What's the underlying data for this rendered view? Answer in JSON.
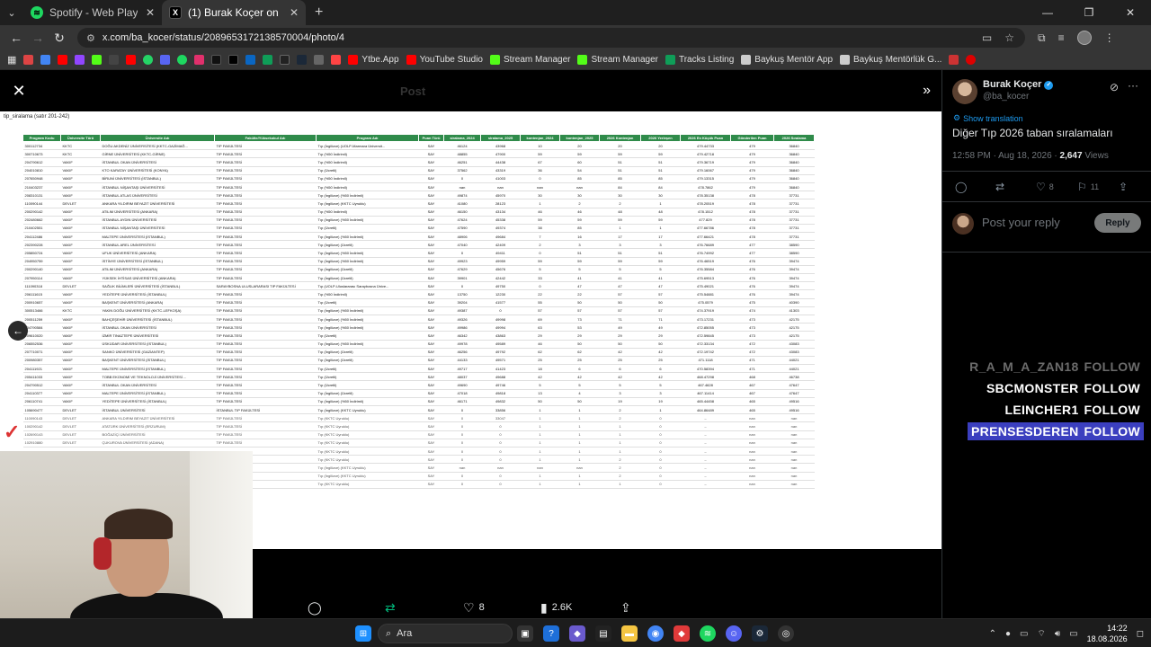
{
  "browser": {
    "tabs": [
      {
        "title": "Spotify - Web Player: Herkes için",
        "icon": "spotify-icon",
        "active": false
      },
      {
        "title": "(1) Burak Koçer on X: \"Geçen se",
        "icon": "x-logo-icon",
        "active": true
      }
    ],
    "url": "x.com/ba_kocer/status/2089653172138570004/photo/4",
    "bookmarks": [
      {
        "label": "Ytbe.App",
        "color": "#ff0000"
      },
      {
        "label": "YouTube Studio",
        "color": "#ff0000"
      },
      {
        "label": "Stream Manager",
        "color": "#53fc18"
      },
      {
        "label": "Stream Manager",
        "color": "#53fc18"
      },
      {
        "label": "Tracks Listing",
        "color": "#0f9d58"
      },
      {
        "label": "Baykuş Mentör App",
        "color": "#cccccc"
      },
      {
        "label": "Baykuş Mentörlük G...",
        "color": "#cccccc"
      }
    ]
  },
  "viewer": {
    "ghost_post_label": "Post",
    "sheet_label": "tip_siralama  (satır 201-242)",
    "table": {
      "headers": [
        "Program Kodu",
        "Üniversite Türü",
        "Üniversite Adı",
        "Fakülte/Yüksekokul Adı",
        "Program Adı",
        "Puan Türü",
        "siralama_2024",
        "siralama_2025",
        "kontenjan_2024",
        "kontenjan_2025",
        "2026 Kontenjan",
        "2026 Yerleşen",
        "2026 En Küçük Puan",
        "Gönderilen Puan",
        "2026 Sıralama"
      ],
      "rows": [
        [
          "300112734",
          "KKTC",
          "DOĞU AKDENİZ ÜNİVERSİTESİ (KKTC-GAZİMAĞ...",
          "TIP FAKÜLTESİ",
          "Tıp (İngilizce) (UOLP-Marmara Üniversit...",
          "SAY",
          "46124",
          "43968",
          "10",
          "20",
          "20",
          "20",
          "479.44733",
          "479",
          "36840"
        ],
        [
          "300710673",
          "KKTC",
          "GİRNE ÜNİVERSİTESİ (KKTC-GİRNE)",
          "TIP FAKÜLTESİ",
          "Tıp (%50 İndirimli)",
          "SAY",
          "48855",
          "47900",
          "59",
          "59",
          "59",
          "59",
          "479.42718",
          "479",
          "36840"
        ],
        [
          "204790612",
          "VAKIF",
          "İSTANBUL OKAN ÜNİVERSİTESİ",
          "TIP FAKÜLTESİ",
          "Tıp (%50 İndirimli)",
          "SAY",
          "46251",
          "44438",
          "67",
          "60",
          "51",
          "51",
          "479.36719",
          "479",
          "36840"
        ],
        [
          "204010810",
          "VAKIF",
          "KTO KARATAY ÜNİVERSİTESİ (KONYA)",
          "TIP FAKÜLTESİ",
          "Tıp (Ücretli)",
          "SAY",
          "37562",
          "43319",
          "36",
          "54",
          "51",
          "51",
          "479.16067",
          "479",
          "36840"
        ],
        [
          "207650948",
          "VAKIF",
          "BİRUNİ ÜNİVERSİTESİ (İSTANBUL)",
          "TIP FAKÜLTESİ",
          "Tıp (%50 İndirimli)",
          "SAY",
          "0",
          "41003",
          "0",
          "85",
          "85",
          "85",
          "479.13315",
          "479",
          "36840"
        ],
        [
          "210403237",
          "VAKIF",
          "İSTANBUL NİŞANTAŞI ÜNİVERSİTESİ",
          "TIP FAKÜLTESİ",
          "Tıp (%50 İndirimli)",
          "SAY",
          "nan",
          "nan",
          "nan",
          "nan",
          "84",
          "84",
          "478.7862",
          "479",
          "36840"
        ],
        [
          "208310131",
          "VAKIF",
          "İSTANBUL ATLAS ÜNİVERSİTESİ",
          "TIP FAKÜLTESİ",
          "Tıp (İngilizce) (%50 İndirimli)",
          "SAY",
          "49874",
          "45970",
          "30",
          "30",
          "30",
          "30",
          "478.35138",
          "478",
          "37731"
        ],
        [
          "110090144",
          "DEVLET",
          "ANKARA YILDIRIM BEYAZIT ÜNİVERSİTESİ",
          "TIP FAKÜLTESİ",
          "Tıp (İngilizce) (KKTC Uyruklu)",
          "SAY",
          "41080",
          "28123",
          "1",
          "2",
          "2",
          "1",
          "478.20519",
          "478",
          "37731"
        ],
        [
          "200290142",
          "VAKIF",
          "ATILIM ÜNİVERSİTESİ (ANKARA)",
          "TIP FAKÜLTESİ",
          "Tıp (%50 İndirimli)",
          "SAY",
          "46150",
          "43134",
          "46",
          "46",
          "48",
          "48",
          "478.1512",
          "478",
          "37731"
        ],
        [
          "202480662",
          "VAKIF",
          "İSTANBUL AYDIN ÜNİVERSİTESİ",
          "TIP FAKÜLTESİ",
          "Tıp (İngilizce) (%50 İndirimli)",
          "SAY",
          "47624",
          "45338",
          "59",
          "59",
          "59",
          "59",
          "477.829",
          "478",
          "37731"
        ],
        [
          "210402551",
          "VAKIF",
          "İSTANBUL NİŞANTAŞI ÜNİVERSİTESİ",
          "TIP FAKÜLTESİ",
          "Tıp (Ücretli)",
          "SAY",
          "47590",
          "49374",
          "38",
          "85",
          "1",
          "1",
          "477.66786",
          "478",
          "37731"
        ],
        [
          "204112486",
          "VAKIF",
          "MALTEPE ÜNİVERSİTESİ (İSTANBUL)",
          "TIP FAKÜLTESİ",
          "Tıp (İngilizce) (%50 İndirimli)",
          "SAY",
          "48906",
          "49684",
          "7",
          "16",
          "17",
          "17",
          "477.66421",
          "478",
          "37731"
        ],
        [
          "202390228",
          "VAKIF",
          "İSTANBUL AREL ÜNİVERSİTESİ",
          "TIP FAKÜLTESİ",
          "Tıp (İngilizce) (Ücretli)",
          "SAY",
          "47040",
          "42409",
          "2",
          "3",
          "3",
          "3",
          "476.76689",
          "477",
          "38590"
        ],
        [
          "205850724",
          "VAKIF",
          "UFUK ÜNİVERSİTESİ (ANKARA)",
          "TIP FAKÜLTESİ",
          "Tıp (İngilizce) (%50 İndirimli)",
          "SAY",
          "0",
          "49411",
          "0",
          "51",
          "51",
          "51",
          "476.74992",
          "477",
          "38590"
        ],
        [
          "204950759",
          "VAKIF",
          "İSTİNYE ÜNİVERSİTESİ (İSTANBUL)",
          "TIP FAKÜLTESİ",
          "Tıp (İngilizce) (%50 İndirimli)",
          "SAY",
          "49923",
          "49959",
          "59",
          "59",
          "59",
          "59",
          "476.46519",
          "476",
          "39474"
        ],
        [
          "200290140",
          "VAKIF",
          "ATILIM ÜNİVERSİTESİ (ANKARA)",
          "TIP FAKÜLTESİ",
          "Tıp (İngilizce) (Ücretli)",
          "SAY",
          "47629",
          "45676",
          "5",
          "5",
          "5",
          "5",
          "476.35584",
          "476",
          "39474"
        ],
        [
          "207950114",
          "VAKIF",
          "YÜKSEK İHTİSAS ÜNİVERSİTESİ (ANKARA)",
          "TIP FAKÜLTESİ",
          "Tıp (İngilizce) (Ücretli)",
          "SAY",
          "39901",
          "42442",
          "33",
          "41",
          "41",
          "41",
          "475.69513",
          "476",
          "39474"
        ],
        [
          "111090318",
          "DEVLET",
          "SAĞLIK BİLİMLERİ ÜNİVERSİTESİ (İSTANBUL)",
          "SARAYBOSNA ULUSLARARASI TIP FAKÜLTESİ",
          "Tıp (UOLP-Uluslararası Saraybosna Ünive...",
          "SAY",
          "0",
          "49750",
          "0",
          "47",
          "47",
          "47",
          "475.49021",
          "476",
          "39474"
        ],
        [
          "206111615",
          "VAKIF",
          "YEDİTEPE ÜNİVERSİTESİ (İSTANBUL)",
          "TIP FAKÜLTESİ",
          "Tıp (%50 İndirimli)",
          "SAY",
          "13750",
          "12230",
          "22",
          "22",
          "57",
          "57",
          "475.54881",
          "476",
          "39474"
        ],
        [
          "200910657",
          "VAKIF",
          "BAŞKENT ÜNİVERSİTESİ (ANKARA)",
          "TIP FAKÜLTESİ",
          "Tıp (Ücretli)",
          "SAY",
          "39204",
          "41577",
          "55",
          "50",
          "50",
          "50",
          "475.0579",
          "475",
          "40390"
        ],
        [
          "300513466",
          "KKTC",
          "YAKIN DOĞU ÜNİVERSİTESİ (KKTC-LEFKOŞA)",
          "TIP FAKÜLTESİ",
          "Tıp (İngilizce) (%50 İndirimli)",
          "SAY",
          "49387",
          "0",
          "57",
          "57",
          "57",
          "57",
          "474.37919",
          "474",
          "41303"
        ],
        [
          "200511259",
          "VAKIF",
          "BAHÇEŞEHİR ÜNİVERSİTESİ (İSTANBUL)",
          "TIP FAKÜLTESİ",
          "Tıp (İngilizce) (%50 İndirimli)",
          "SAY",
          "49326",
          "49998",
          "69",
          "73",
          "71",
          "71",
          "473.17231",
          "473",
          "42175"
        ],
        [
          "204790584",
          "VAKIF",
          "İSTANBUL OKAN ÜNİVERSİTESİ",
          "TIP FAKÜLTESİ",
          "Tıp (İngilizce) (%50 İndirimli)",
          "SAY",
          "49986",
          "49994",
          "63",
          "53",
          "49",
          "49",
          "472.85055",
          "473",
          "42175"
        ],
        [
          "209610020",
          "VAKIF",
          "İZMİR TINAZTEPE ÜNİVERSİTESİ",
          "TIP FAKÜLTESİ",
          "Tıp (Ücretli)",
          "SAY",
          "46342",
          "43863",
          "29",
          "29",
          "29",
          "29",
          "472.59845",
          "473",
          "42175"
        ],
        [
          "206552536",
          "VAKIF",
          "ÜSKÜDAR ÜNİVERSİTESİ (İSTANBUL)",
          "TIP FAKÜLTESİ",
          "Tıp (İngilizce) (%50 İndirimli)",
          "SAY",
          "49978",
          "49589",
          "46",
          "50",
          "50",
          "50",
          "472.33134",
          "472",
          "43083"
        ],
        [
          "207710071",
          "VAKIF",
          "SANKO ÜNİVERSİTESİ (GAZİANTEP)",
          "TIP FAKÜLTESİ",
          "Tıp (İngilizce) (Ücretli)",
          "SAY",
          "46256",
          "49792",
          "62",
          "62",
          "42",
          "42",
          "472.19742",
          "472",
          "43083"
        ],
        [
          "200980357",
          "VAKIF",
          "BAŞKENT ÜNİVERSİTESİ (İSTANBUL)",
          "TIP FAKÜLTESİ",
          "Tıp (İngilizce) (Ücretli)",
          "SAY",
          "44133",
          "49571",
          "25",
          "25",
          "25",
          "25",
          "471.1118",
          "471",
          "44021"
        ],
        [
          "204111921",
          "VAKIF",
          "MALTEPE ÜNİVERSİTESİ (İSTANBUL)",
          "TIP FAKÜLTESİ",
          "Tıp (Ücretli)",
          "SAY",
          "49717",
          "41423",
          "18",
          "6",
          "6",
          "6",
          "470.58394",
          "471",
          "44021"
        ],
        [
          "205411033",
          "VAKIF",
          "TOBB EKONOMİ VE TEKNOLOJİ ÜNİVERSİTESİ ...",
          "TIP FAKÜLTESİ",
          "Tıp (Ücretli)",
          "SAY",
          "48037",
          "49688",
          "42",
          "42",
          "42",
          "42",
          "468.47298",
          "468",
          "46738"
        ],
        [
          "204790512",
          "VAKIF",
          "İSTANBUL OKAN ÜNİVERSİTESİ",
          "TIP FAKÜLTESİ",
          "Tıp (Ücretli)",
          "SAY",
          "49690",
          "49746",
          "5",
          "5",
          "5",
          "5",
          "467.4628",
          "467",
          "47647"
        ],
        [
          "204110377",
          "VAKIF",
          "MALTEPE ÜNİVERSİTESİ (İSTANBUL)",
          "TIP FAKÜLTESİ",
          "Tıp (İngilizce) (Ücretli)",
          "SAY",
          "47018",
          "49818",
          "13",
          "4",
          "3",
          "3",
          "467.11414",
          "467",
          "47647"
        ],
        [
          "206110741",
          "VAKIF",
          "YEDİTEPE ÜNİVERSİTESİ (İSTANBUL)",
          "TIP FAKÜLTESİ",
          "Tıp (İngilizce) (%50 İndirimli)",
          "SAY",
          "46171",
          "49832",
          "50",
          "50",
          "19",
          "19",
          "465.44458",
          "465",
          "49516"
        ],
        [
          "105690477",
          "DEVLET",
          "İSTANBUL ÜNİVERSİTESİ",
          "İSTANBUL TIP FAKÜLTESİ",
          "Tıp (İngilizce) (KKTC Uyruklu)",
          "SAY",
          "0",
          "33856",
          "1",
          "1",
          "2",
          "1",
          "464.86489",
          "465",
          "49516"
        ],
        [
          "110090143",
          "DEVLET",
          "ANKARA YILDIRIM BEYAZIT ÜNİVERSİTESİ",
          "TIP FAKÜLTESİ",
          "Tıp (KKTC Uyruklu)",
          "SAY",
          "0",
          "33047",
          "1",
          "1",
          "2",
          "0",
          "–",
          "nan",
          "nan"
        ],
        [
          "100290142",
          "DEVLET",
          "ATATÜRK ÜNİVERSİTESİ (ERZURUM)",
          "TIP FAKÜLTESİ",
          "Tıp (KKTC Uyruklu)",
          "SAY",
          "0",
          "0",
          "1",
          "1",
          "1",
          "0",
          "–",
          "nan",
          "nan"
        ],
        [
          "102690143",
          "DEVLET",
          "BOĞAZİÇİ ÜNİVERSİTESİ",
          "TIP FAKÜLTESİ",
          "Tıp (KKTC Uyruklu)",
          "SAY",
          "0",
          "0",
          "1",
          "1",
          "1",
          "0",
          "–",
          "nan",
          "nan"
        ],
        [
          "102910880",
          "DEVLET",
          "ÇUKUROVA ÜNİVERSİTESİ (ADANA)",
          "TIP FAKÜLTESİ",
          "Tıp (KKTC Uyruklu)",
          "SAY",
          "0",
          "0",
          "1",
          "1",
          "1",
          "0",
          "–",
          "nan",
          "nan"
        ],
        [
          "",
          "",
          "",
          "",
          "Tıp (KKTC Uyruklu)",
          "SAY",
          "0",
          "0",
          "1",
          "1",
          "1",
          "0",
          "–",
          "nan",
          "nan"
        ],
        [
          "",
          "",
          "",
          "",
          "Tıp (KKTC Uyruklu)",
          "SAY",
          "0",
          "0",
          "1",
          "1",
          "2",
          "0",
          "–",
          "nan",
          "nan"
        ],
        [
          "",
          "",
          "",
          "",
          "Tıp (İngilizce) (KKTC Uyruklu)",
          "SAY",
          "nan",
          "nan",
          "nan",
          "nan",
          "2",
          "0",
          "–",
          "nan",
          "nan"
        ],
        [
          "",
          "",
          "",
          "",
          "Tıp (İngilizce) (KKTC Uyruklu)",
          "SAY",
          "0",
          "0",
          "1",
          "1",
          "2",
          "0",
          "–",
          "nan",
          "nan"
        ],
        [
          "",
          "",
          "",
          "",
          "Tıp (KKTC Uyruklu)",
          "SAY",
          "0",
          "0",
          "1",
          "1",
          "1",
          "0",
          "–",
          "nan",
          "nan"
        ]
      ]
    },
    "actions": {
      "likes": "8",
      "views": "2.6K"
    }
  },
  "tweet": {
    "author_name": "Burak Koçer",
    "author_handle": "@ba_kocer",
    "show_translation": "Show translation",
    "text": "Diğer Tıp 2026 taban sıralamaları",
    "time": "12:58 PM · Aug 18, 2026 · ",
    "views_count": "2,647",
    "views_label": " Views",
    "likes": "8",
    "bookmarks": "11",
    "reply_placeholder": "Post your reply",
    "reply_button": "Reply"
  },
  "follow_alerts": [
    {
      "user": "R_A_M_A_ZAN18",
      "label": "FOLLOW",
      "style": "faded"
    },
    {
      "user": "SBCMONSTER",
      "label": "FOLLOW",
      "style": "normal"
    },
    {
      "user": "LEINCHER1",
      "label": "FOLLOW",
      "style": "normal"
    },
    {
      "user": "PRENSESDEREN",
      "label": "FOLLOW",
      "style": "hl"
    }
  ],
  "taskbar": {
    "search_label": "Ara",
    "time": "14:22",
    "date": "18.08.2026"
  }
}
